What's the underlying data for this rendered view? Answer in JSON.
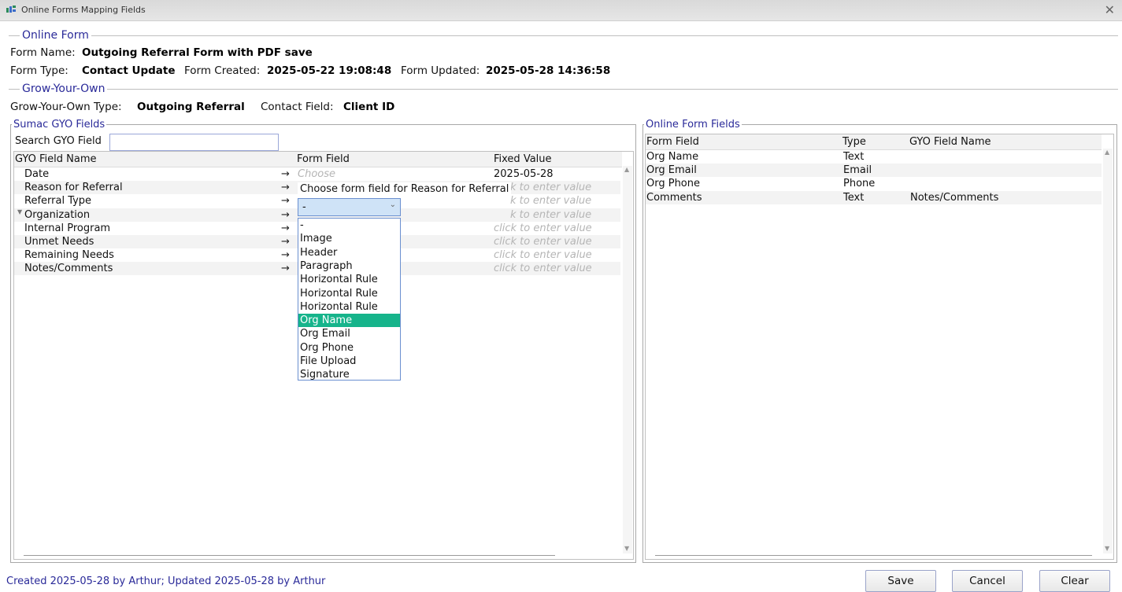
{
  "window": {
    "title": "Online Forms Mapping Fields",
    "close": "✕"
  },
  "online_form": {
    "section_title": "Online Form",
    "form_name_label": "Form Name:",
    "form_name": "Outgoing Referral Form with PDF save",
    "form_type_label": "Form Type:",
    "form_type": "Contact Update",
    "form_created_label": "Form Created:",
    "form_created": "2025-05-22 19:08:48",
    "form_updated_label": "Form Updated:",
    "form_updated": "2025-05-28 14:36:58"
  },
  "gyo": {
    "section_title": "Grow-Your-Own",
    "type_label": "Grow-Your-Own Type:",
    "type": "Outgoing Referral",
    "contact_field_label": "Contact Field:",
    "contact_field": "Client ID"
  },
  "left_panel": {
    "title": "Sumac GYO Fields",
    "search_label": "Search GYO Field",
    "search_value": "",
    "columns": [
      "GYO Field Name",
      "Form Field",
      "Fixed Value"
    ],
    "rows": [
      {
        "name": "Date",
        "arrow": "→",
        "form_field": "Choose",
        "fixed": "2025-05-28"
      },
      {
        "name": "Reason for Referral",
        "arrow": "→",
        "form_field": "",
        "fixed": "k to enter value"
      },
      {
        "name": "Referral Type",
        "arrow": "→",
        "form_field": "",
        "fixed": "k to enter value"
      },
      {
        "name": "Organization",
        "arrow": "→",
        "form_field": "",
        "fixed": "k to enter value"
      },
      {
        "name": "Internal Program",
        "arrow": "→",
        "form_field": "",
        "fixed": "click to enter value"
      },
      {
        "name": "Unmet Needs",
        "arrow": "→",
        "form_field": "",
        "fixed": "click to enter value"
      },
      {
        "name": "Remaining Needs",
        "arrow": "→",
        "form_field": "",
        "fixed": "click to enter value"
      },
      {
        "name": "Notes/Comments",
        "arrow": "→",
        "form_field": "",
        "fixed": "click to enter value"
      }
    ],
    "tooltip": "Choose form field for Reason for Referral",
    "combo_value": "-",
    "dropdown_options": [
      "-",
      "Image",
      "Header",
      "Paragraph",
      "Horizontal Rule",
      "Horizontal Rule",
      "Horizontal Rule",
      "Org Name",
      "Org Email",
      "Org Phone",
      "File Upload",
      "Signature"
    ],
    "dropdown_selected": "Org Name"
  },
  "right_panel": {
    "title": "Online Form Fields",
    "columns": [
      "Form Field",
      "Type",
      "GYO Field Name"
    ],
    "rows": [
      {
        "field": "Org Name",
        "type": "Text",
        "gyo": ""
      },
      {
        "field": "Org Email",
        "type": "Email",
        "gyo": ""
      },
      {
        "field": "Org Phone",
        "type": "Phone",
        "gyo": ""
      },
      {
        "field": "Comments",
        "type": "Text",
        "gyo": "Notes/Comments"
      }
    ]
  },
  "footer": {
    "status": "Created 2025-05-28 by Arthur; Updated 2025-05-28 by Arthur",
    "save": "Save",
    "cancel": "Cancel",
    "clear": "Clear"
  },
  "colors": {
    "accent": "#2a2a99",
    "selection": "#16b48b",
    "combo_bg": "#cfe3f7"
  }
}
